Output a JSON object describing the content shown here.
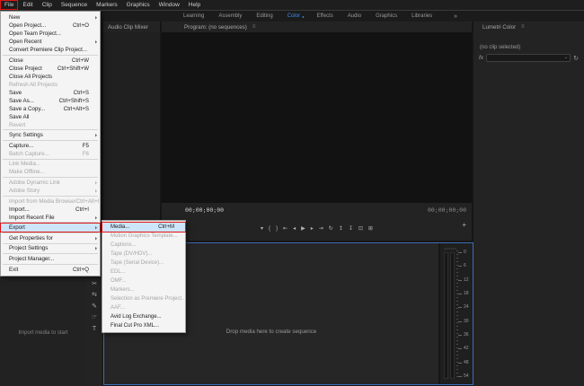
{
  "colors": {
    "accent_blue": "#3d8ceb",
    "annotation_red": "#e01414",
    "menu_highlight_blue": "#cde5fa",
    "focus_border_blue": "#3e6db5"
  },
  "menu_bar": {
    "items": [
      {
        "label": "File",
        "annotated": true
      },
      {
        "label": "Edit"
      },
      {
        "label": "Clip"
      },
      {
        "label": "Sequence"
      },
      {
        "label": "Markers"
      },
      {
        "label": "Graphics"
      },
      {
        "label": "Window"
      },
      {
        "label": "Help"
      }
    ]
  },
  "workspace_tabs": {
    "items": [
      {
        "label": "Learning"
      },
      {
        "label": "Assembly"
      },
      {
        "label": "Editing"
      },
      {
        "label": "Color",
        "active": true,
        "dot": "●"
      },
      {
        "label": "Effects"
      },
      {
        "label": "Audio"
      },
      {
        "label": "Graphics"
      },
      {
        "label": "Libraries"
      }
    ],
    "overflow": "»"
  },
  "file_menu": {
    "items": [
      {
        "label": "New",
        "arrow": "⏵"
      },
      {
        "label": "Open Project...",
        "shortcut": "Ctrl+O"
      },
      {
        "label": "Open Team Project..."
      },
      {
        "label": "Open Recent",
        "arrow": "⏵"
      },
      {
        "label": "Convert Premiere Clip Project..."
      },
      {
        "separator": true
      },
      {
        "label": "Close",
        "shortcut": "Ctrl+W"
      },
      {
        "label": "Close Project",
        "shortcut": "Ctrl+Shift+W"
      },
      {
        "label": "Close All Projects"
      },
      {
        "label": "Refresh All Projects",
        "disabled": true
      },
      {
        "label": "Save",
        "shortcut": "Ctrl+S"
      },
      {
        "label": "Save As...",
        "shortcut": "Ctrl+Shift+S"
      },
      {
        "label": "Save a Copy...",
        "shortcut": "Ctrl+Alt+S"
      },
      {
        "label": "Save All"
      },
      {
        "label": "Revert",
        "disabled": true
      },
      {
        "separator": true
      },
      {
        "label": "Sync Settings",
        "arrow": "⏵"
      },
      {
        "separator": true
      },
      {
        "label": "Capture...",
        "shortcut": "F5"
      },
      {
        "label": "Batch Capture...",
        "shortcut": "F6",
        "disabled": true
      },
      {
        "separator": true
      },
      {
        "label": "Link Media...",
        "disabled": true
      },
      {
        "label": "Make Offline...",
        "disabled": true
      },
      {
        "separator": true
      },
      {
        "label": "Adobe Dynamic Link",
        "arrow": "⏵",
        "disabled": true
      },
      {
        "label": "Adobe Story",
        "arrow": "⏵",
        "disabled": true
      },
      {
        "separator": true
      },
      {
        "label": "Import from Media Browser",
        "shortcut": "Ctrl+Alt+I",
        "disabled": true
      },
      {
        "label": "Import...",
        "shortcut": "Ctrl+I"
      },
      {
        "label": "Import Recent File",
        "arrow": "⏵"
      },
      {
        "separator": true
      },
      {
        "label": "Export",
        "arrow": "⏵",
        "highlighted": true,
        "annotated": true
      },
      {
        "separator": true
      },
      {
        "label": "Get Properties for",
        "arrow": "⏵"
      },
      {
        "separator": true
      },
      {
        "label": "Project Settings",
        "arrow": "⏵"
      },
      {
        "separator": true
      },
      {
        "label": "Project Manager..."
      },
      {
        "separator": true
      },
      {
        "label": "Exit",
        "shortcut": "Ctrl+Q"
      }
    ]
  },
  "export_submenu": {
    "items": [
      {
        "label": "Media...",
        "shortcut": "Ctrl+M",
        "highlighted": true,
        "annotated": true
      },
      {
        "label": "Motion Graphics Template...",
        "disabled": true
      },
      {
        "label": "Captions...",
        "disabled": true
      },
      {
        "label": "Tape (DV/HDV)...",
        "disabled": true
      },
      {
        "label": "Tape (Serial Device)...",
        "disabled": true
      },
      {
        "label": "EDL...",
        "disabled": true
      },
      {
        "label": "OMF...",
        "disabled": true
      },
      {
        "label": "Markers...",
        "disabled": true
      },
      {
        "label": "Selection as Premiere Project...",
        "disabled": true
      },
      {
        "label": "AAF...",
        "disabled": true
      },
      {
        "label": "Avid Log Exchange..."
      },
      {
        "label": "Final Cut Pro XML..."
      }
    ]
  },
  "mixer_panel": {
    "title": "Audio Clip Mixer"
  },
  "program_panel": {
    "title": "Program: (no sequences)",
    "menu_icon": "≡",
    "timecode_left": "00;00;00;00",
    "timecode_right": "00;00;00;00",
    "add_button": "+",
    "transport": [
      {
        "name": "add-marker-button",
        "glyph": "▾"
      },
      {
        "name": "mark-in-button",
        "glyph": "{"
      },
      {
        "name": "mark-out-button",
        "glyph": "}"
      },
      {
        "name": "go-to-in-button",
        "glyph": "⇤"
      },
      {
        "name": "step-back-button",
        "glyph": "◂"
      },
      {
        "name": "play-button",
        "glyph": "▶"
      },
      {
        "name": "step-forward-button",
        "glyph": "▸"
      },
      {
        "name": "go-to-out-button",
        "glyph": "⇥"
      },
      {
        "name": "loop-button",
        "glyph": "↻"
      },
      {
        "name": "lift-button",
        "glyph": "↥"
      },
      {
        "name": "extract-button",
        "glyph": "↧"
      },
      {
        "name": "export-frame-button",
        "glyph": "⊡"
      },
      {
        "name": "comparison-view-button",
        "glyph": "⊞"
      }
    ]
  },
  "lumetri_panel": {
    "title": "Lumetri Color",
    "menu_icon": "≡",
    "status": "(no clip selected)",
    "fx_badge": "fx",
    "dropdown_value": "",
    "dropdown_chevron": "⌄",
    "reset_glyph": "↻"
  },
  "project_panel": {
    "empty_text": "Import media to start"
  },
  "tools_panel": {
    "tools": [
      {
        "name": "selection-tool",
        "glyph": "↖"
      },
      {
        "name": "track-select-tool",
        "glyph": "⇥"
      },
      {
        "name": "ripple-edit-tool",
        "glyph": "⇹"
      },
      {
        "name": "razor-tool",
        "glyph": "✂"
      },
      {
        "name": "slip-tool",
        "glyph": "⇆"
      },
      {
        "name": "pen-tool",
        "glyph": "✎"
      },
      {
        "name": "hand-tool",
        "glyph": "☞"
      },
      {
        "name": "type-tool",
        "glyph": "T"
      }
    ]
  },
  "timeline_panel": {
    "empty_text": "Drop media here to create sequence"
  },
  "audio_meter_panel": {
    "db_labels": [
      "0",
      "6",
      "12",
      "18",
      "24",
      "30",
      "36",
      "42",
      "48",
      "54"
    ]
  }
}
